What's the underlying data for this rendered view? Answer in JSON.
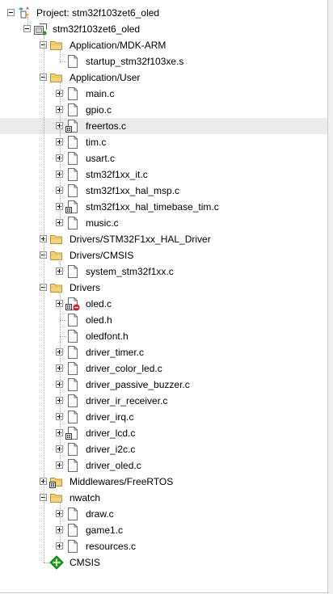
{
  "project_tree": {
    "project": {
      "label": "Project: stm32f103zet6_oled",
      "expanded": true,
      "icon": "project-icon"
    },
    "target": {
      "label": "stm32f103zet6_oled",
      "expanded": true,
      "icon": "target-icon"
    },
    "groups": [
      {
        "label": "Application/MDK-ARM",
        "expanded": true,
        "files": [
          {
            "label": "startup_stm32f103xe.s",
            "icon": "asm-file-icon",
            "expandable": false
          }
        ]
      },
      {
        "label": "Application/User",
        "expanded": true,
        "files": [
          {
            "label": "main.c",
            "icon": "c-file-icon",
            "expandable": true
          },
          {
            "label": "gpio.c",
            "icon": "c-file-icon",
            "expandable": true
          },
          {
            "label": "freertos.c",
            "icon": "c-file-options-icon",
            "expandable": true,
            "selected": true
          },
          {
            "label": "tim.c",
            "icon": "c-file-icon",
            "expandable": true
          },
          {
            "label": "usart.c",
            "icon": "c-file-icon",
            "expandable": true
          },
          {
            "label": "stm32f1xx_it.c",
            "icon": "c-file-icon",
            "expandable": true
          },
          {
            "label": "stm32f1xx_hal_msp.c",
            "icon": "c-file-icon",
            "expandable": true
          },
          {
            "label": "stm32f1xx_hal_timebase_tim.c",
            "icon": "c-file-options-icon",
            "expandable": true
          },
          {
            "label": "music.c",
            "icon": "c-file-icon",
            "expandable": true
          }
        ]
      },
      {
        "label": "Drivers/STM32F1xx_HAL_Driver",
        "expanded": false,
        "files": []
      },
      {
        "label": "Drivers/CMSIS",
        "expanded": true,
        "files": [
          {
            "label": "system_stm32f1xx.c",
            "icon": "c-file-icon",
            "expandable": true
          }
        ]
      },
      {
        "label": "Drivers",
        "expanded": true,
        "files": [
          {
            "label": "oled.c",
            "icon": "c-file-error-icon",
            "expandable": true
          },
          {
            "label": "oled.h",
            "icon": "h-file-icon",
            "expandable": false
          },
          {
            "label": "oledfont.h",
            "icon": "h-file-icon",
            "expandable": false
          },
          {
            "label": "driver_timer.c",
            "icon": "c-file-icon",
            "expandable": true
          },
          {
            "label": "driver_color_led.c",
            "icon": "c-file-icon",
            "expandable": true
          },
          {
            "label": "driver_passive_buzzer.c",
            "icon": "c-file-icon",
            "expandable": true
          },
          {
            "label": "driver_ir_receiver.c",
            "icon": "c-file-icon",
            "expandable": true
          },
          {
            "label": "driver_irq.c",
            "icon": "c-file-icon",
            "expandable": true
          },
          {
            "label": "driver_lcd.c",
            "icon": "c-file-options-icon",
            "expandable": true
          },
          {
            "label": "driver_i2c.c",
            "icon": "c-file-icon",
            "expandable": true
          },
          {
            "label": "driver_oled.c",
            "icon": "c-file-icon",
            "expandable": true
          }
        ]
      },
      {
        "label": "Middlewares/FreeRTOS",
        "expanded": false,
        "icon": "folder-options-icon",
        "files": []
      },
      {
        "label": "nwatch",
        "expanded": true,
        "files": [
          {
            "label": "draw.c",
            "icon": "c-file-icon",
            "expandable": true
          },
          {
            "label": "game1.c",
            "icon": "c-file-icon",
            "expandable": true
          },
          {
            "label": "resources.c",
            "icon": "c-file-icon",
            "expandable": true
          }
        ]
      }
    ],
    "extra": {
      "label": "CMSIS",
      "icon": "rte-component-icon"
    }
  },
  "colors": {
    "folder": "#f5d37a",
    "selected_row": "#ebebeb",
    "rte_green": "#1aa01a",
    "error_red": "#d81c1c"
  }
}
